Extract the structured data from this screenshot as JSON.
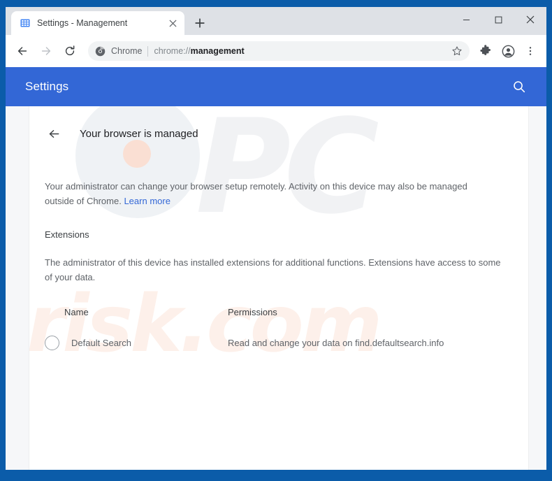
{
  "window": {
    "controls": {
      "minimize_label": "Minimize",
      "maximize_label": "Maximize",
      "close_label": "Close"
    }
  },
  "browser": {
    "tab": {
      "title": "Settings - Management",
      "favicon": "management-building-icon",
      "close_label": "Close tab"
    },
    "new_tab_label": "New tab",
    "nav": {
      "back_label": "Back",
      "forward_label": "Forward",
      "reload_label": "Reload"
    },
    "omnibox": {
      "brand_icon": "chrome-logo-icon",
      "brand_label": "Chrome",
      "url_scheme": "chrome://",
      "url_host": "management",
      "url_full": "chrome://management",
      "bookmark_label": "Bookmark this tab"
    },
    "toolbar_icons": {
      "extensions_label": "Extensions",
      "profile_label": "Profile",
      "menu_label": "Customize and control Google Chrome"
    }
  },
  "settings_header": {
    "title": "Settings",
    "search_label": "Search settings",
    "accent_color": "#3367d6"
  },
  "page": {
    "back_label": "Back",
    "title": "Your browser is managed",
    "managed_description": "Your administrator can change your browser setup remotely. Activity on this device may also be managed outside of Chrome. ",
    "learn_more_label": "Learn more",
    "extensions_heading": "Extensions",
    "extensions_description": "The administrator of this device has installed extensions for additional functions. Extensions have access to some of your data."
  },
  "extensions_table": {
    "columns": [
      "Name",
      "Permissions"
    ],
    "rows": [
      {
        "icon": "extension-placeholder-icon",
        "name": "Default Search",
        "permissions": "Read and change your data on find.defaultsearch.info"
      }
    ]
  },
  "watermark": {
    "logo_text": "PC",
    "site_text": "risk.com"
  }
}
